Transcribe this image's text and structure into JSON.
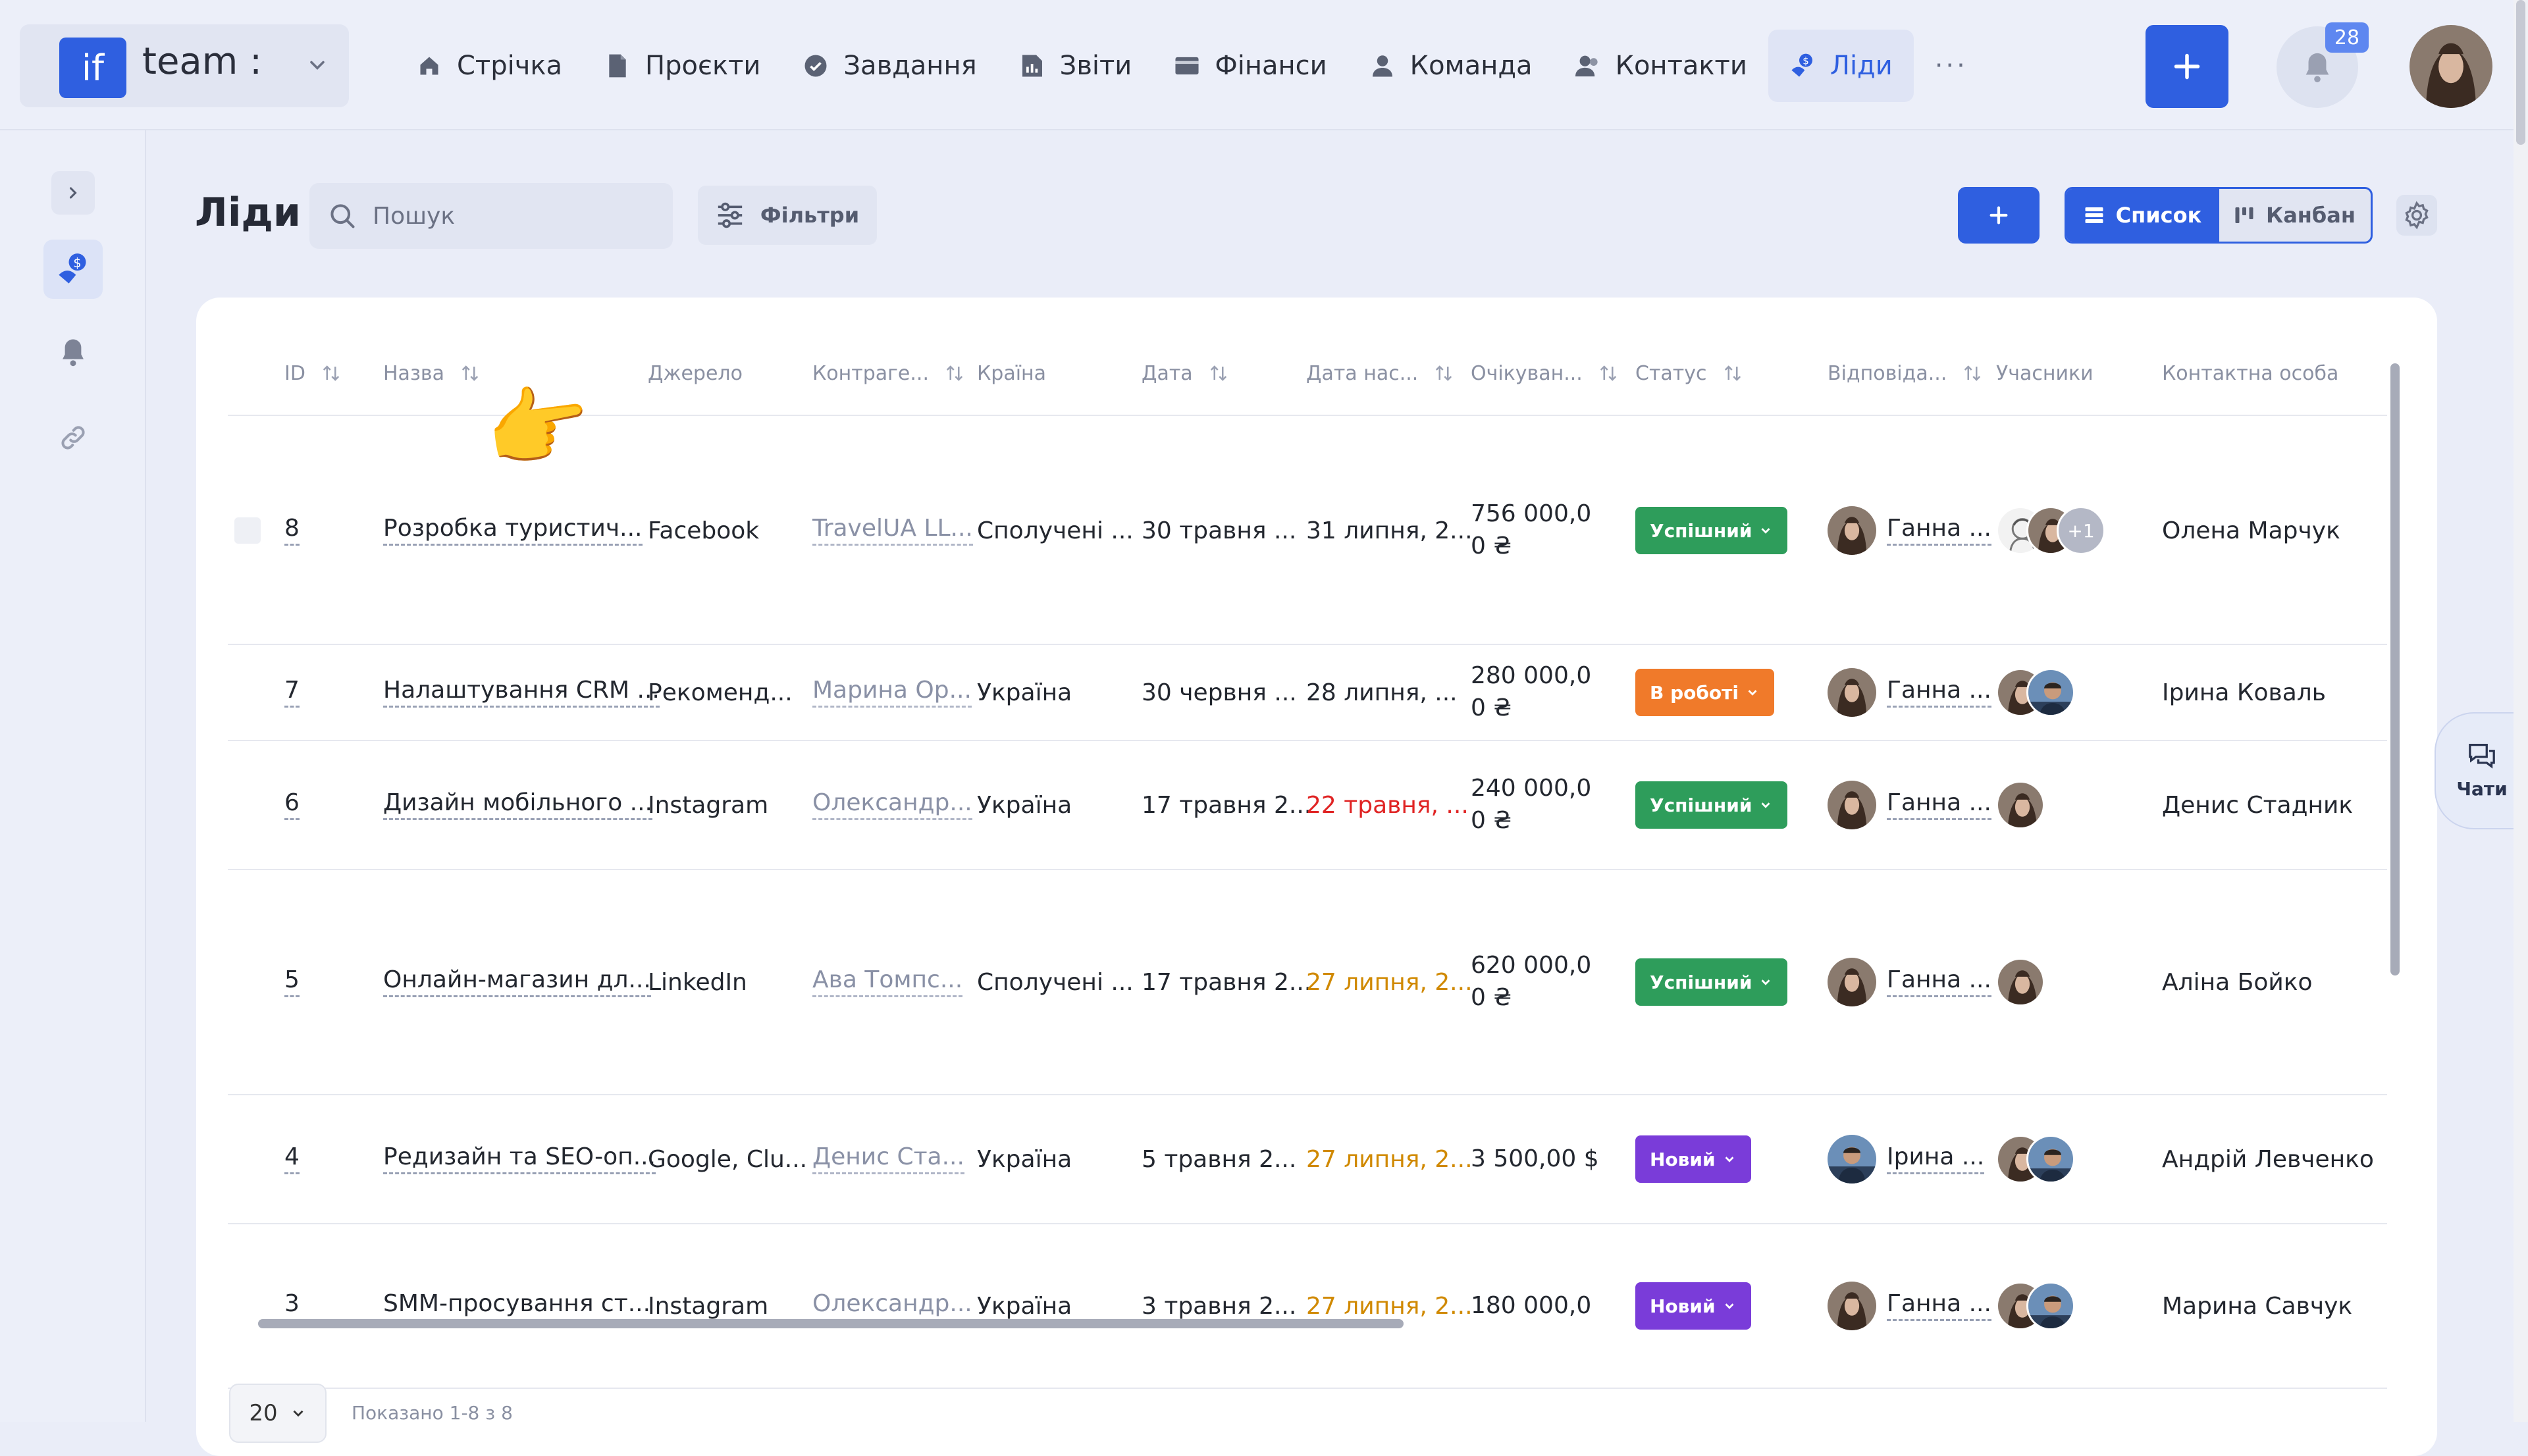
{
  "app": {
    "brand_short": "if",
    "brand_name": "team :",
    "notifications_count": "28"
  },
  "nav": [
    {
      "label": "Стрічка",
      "icon": "home-icon"
    },
    {
      "label": "Проєкти",
      "icon": "file-icon"
    },
    {
      "label": "Завдання",
      "icon": "check-circle-icon"
    },
    {
      "label": "Звіти",
      "icon": "report-icon"
    },
    {
      "label": "Фінанси",
      "icon": "wallet-icon"
    },
    {
      "label": "Команда",
      "icon": "user-icon"
    },
    {
      "label": "Контакти",
      "icon": "contacts-icon"
    },
    {
      "label": "Ліди",
      "icon": "leads-icon",
      "active": true
    }
  ],
  "nav_more": "···",
  "page": {
    "title": "Ліди",
    "search_placeholder": "Пошук",
    "filters_label": "Фільтри",
    "add_label": "+",
    "view_list": "Список",
    "view_kanban": "Канбан"
  },
  "columns": [
    "ID",
    "Назва",
    "Джерело",
    "Контраге...",
    "Країна",
    "Дата",
    "Дата нас...",
    "Очікуван...",
    "Статус",
    "Відповіда...",
    "Учасники",
    "Контактна особа"
  ],
  "rows": [
    {
      "id": "8",
      "name": "Розробка туристич...",
      "source": "Facebook",
      "counterparty": "TravelUA LL...",
      "country": "Сполучені ...",
      "date": "30 травня ...",
      "next_date": "31 липня, 2...",
      "next_color": "normal",
      "amount_1": "756 000,0",
      "amount_2": "0 ₴",
      "status": "Успішний",
      "status_type": "success",
      "responsible": "Ганна ...",
      "participants": [
        "sketch",
        "woman",
        "+1"
      ],
      "contact": "Олена Марчук"
    },
    {
      "id": "7",
      "name": "Налаштування CRM ...",
      "source": "Рекоменд...",
      "counterparty": "Марина Ор...",
      "country": "Україна",
      "date": "30 червня ...",
      "next_date": "28 липня, ...",
      "next_color": "normal",
      "amount_1": "280 000,0",
      "amount_2": "0 ₴",
      "status": "В роботі",
      "status_type": "work",
      "responsible": "Ганна ...",
      "participants": [
        "woman",
        "man"
      ],
      "contact": "Ірина Коваль"
    },
    {
      "id": "6",
      "name": "Дизайн мобільного ...",
      "source": "Instagram",
      "counterparty": "Олександр...",
      "country": "Україна",
      "date": "17 травня 2...",
      "next_date": "22 травня, ...",
      "next_color": "red",
      "amount_1": "240 000,0",
      "amount_2": "0 ₴",
      "status": "Успішний",
      "status_type": "success",
      "responsible": "Ганна ...",
      "participants": [
        "woman"
      ],
      "contact": "Денис Стадник"
    },
    {
      "id": "5",
      "name": "Онлайн-магазин дл...",
      "source": "LinkedIn",
      "counterparty": "Ава Томпс...",
      "country": "Сполучені ...",
      "date": "17 травня 2...",
      "next_date": "27 липня, 2...",
      "next_color": "orange",
      "amount_1": "620 000,0",
      "amount_2": "0 ₴",
      "status": "Успішний",
      "status_type": "success",
      "responsible": "Ганна ...",
      "participants": [
        "woman"
      ],
      "contact": "Аліна Бойко"
    },
    {
      "id": "4",
      "name": "Редизайн та SEO-оп...",
      "source": "Google, Clu...",
      "counterparty": "Денис Ста...",
      "country": "Україна",
      "date": "5 травня 2...",
      "next_date": "27 липня, 2...",
      "next_color": "orange",
      "amount_1": "3 500,00 $",
      "amount_2": "",
      "status": "Новий",
      "status_type": "new",
      "responsible": "Ірина ...",
      "participants": [
        "woman",
        "man"
      ],
      "contact": "Андрій Левченко"
    },
    {
      "id": "3",
      "name": "SMM-просування ст...",
      "source": "Instagram",
      "counterparty": "Олександр...",
      "country": "Україна",
      "date": "3 травня 2...",
      "next_date": "27 липня, 2...",
      "next_color": "orange",
      "amount_1": "180 000,0",
      "amount_2": "",
      "status": "Новий",
      "status_type": "new",
      "responsible": "Ганна ...",
      "participants": [
        "woman",
        "man"
      ],
      "contact": "Марина Савчук"
    }
  ],
  "pager": {
    "per_page": "20",
    "shown": "Показано 1-8 з 8"
  },
  "chat_label": "Чати",
  "colors": {
    "accent": "#2f5fe0",
    "success": "#2e9d5b",
    "work": "#f07a2a",
    "new": "#7a3cd9",
    "overdue": "#e02424",
    "soon": "#d08900"
  }
}
